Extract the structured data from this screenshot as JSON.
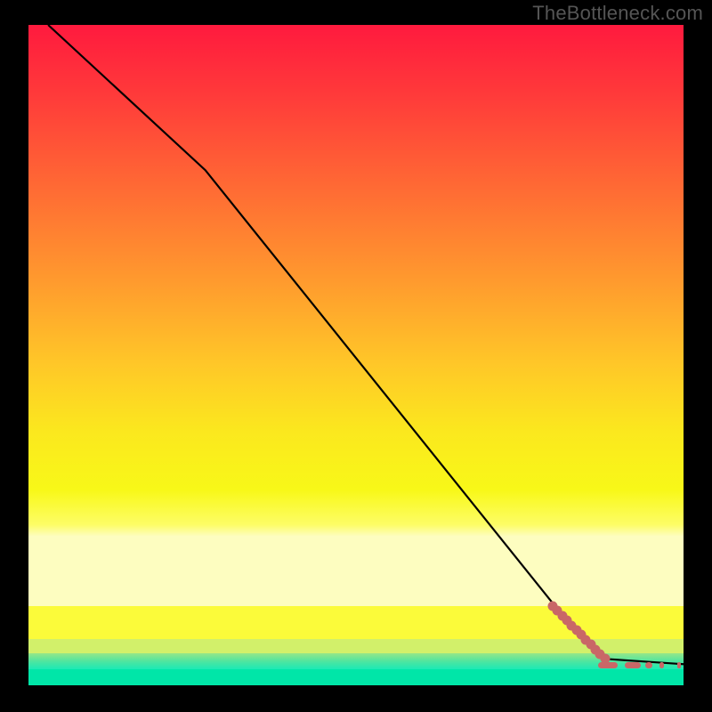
{
  "watermark": "TheBottleneck.com",
  "colors": {
    "curve": "#000000",
    "marker": "#c96767",
    "teal": "#00e6a8"
  },
  "chart_data": {
    "type": "line",
    "title": "",
    "xlabel": "",
    "ylabel": "",
    "xlim": [
      0,
      100
    ],
    "ylim": [
      0,
      100
    ],
    "grid": false,
    "curve": [
      {
        "x": 3,
        "y": 100
      },
      {
        "x": 27,
        "y": 78
      },
      {
        "x": 82,
        "y": 10
      },
      {
        "x": 88,
        "y": 4
      },
      {
        "x": 100,
        "y": 3.2
      }
    ],
    "dense_markers_range": {
      "start_x": 80,
      "end_x": 88,
      "y_start": 12,
      "y_end": 4
    },
    "baseline_marker_groups": [
      {
        "x_start": 87,
        "x_end": 90,
        "y": 3.0
      },
      {
        "x_start": 91,
        "x_end": 93.5,
        "y": 3.0
      },
      {
        "x_start": 94.2,
        "x_end": 95.2,
        "y": 3.0
      },
      {
        "x_start": 96.3,
        "x_end": 97.0,
        "y": 3.0
      },
      {
        "x_start": 99.0,
        "x_end": 99.6,
        "y": 3.0
      }
    ]
  }
}
